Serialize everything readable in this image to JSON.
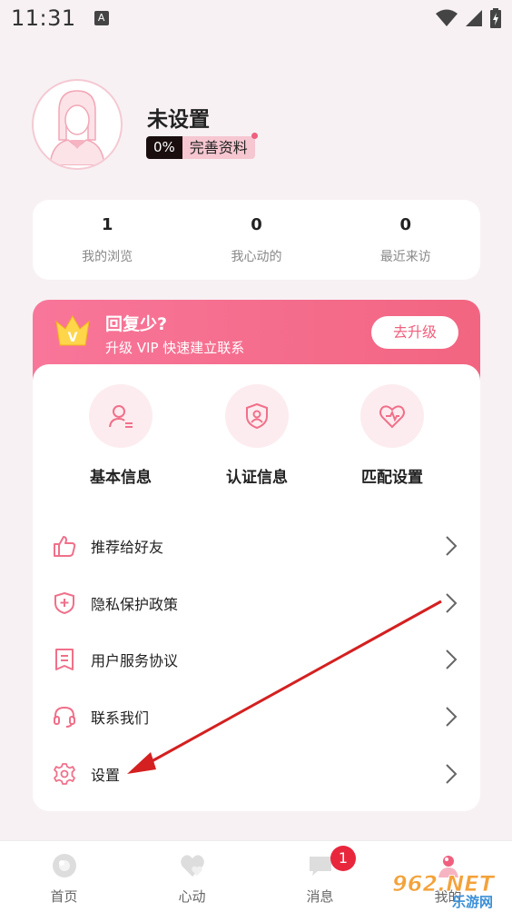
{
  "status_bar": {
    "time": "11:31",
    "notification_icon": "A"
  },
  "profile": {
    "nickname": "未设置",
    "completion_percent": "0%",
    "completion_label": "完善资料"
  },
  "stats": [
    {
      "count": "1",
      "label": "我的浏览"
    },
    {
      "count": "0",
      "label": "我心动的"
    },
    {
      "count": "0",
      "label": "最近来访"
    }
  ],
  "vip_banner": {
    "title": "回复少?",
    "subtitle": "升级 VIP 快速建立联系",
    "button_label": "去升级",
    "crown_letter": "V"
  },
  "quick_actions": [
    {
      "label": "基本信息",
      "icon": "user-profile-icon"
    },
    {
      "label": "认证信息",
      "icon": "shield-verify-icon"
    },
    {
      "label": "匹配设置",
      "icon": "heart-match-icon"
    }
  ],
  "menu": [
    {
      "label": "推荐给好友",
      "icon": "thumbs-up-icon"
    },
    {
      "label": "隐私保护政策",
      "icon": "shield-plus-icon"
    },
    {
      "label": "用户服务协议",
      "icon": "document-icon"
    },
    {
      "label": "联系我们",
      "icon": "headset-icon"
    },
    {
      "label": "设置",
      "icon": "gear-icon"
    }
  ],
  "tab_bar": [
    {
      "label": "首页",
      "icon": "home-icon"
    },
    {
      "label": "心动",
      "icon": "heart-icon"
    },
    {
      "label": "消息",
      "icon": "message-icon",
      "badge": "1"
    },
    {
      "label": "我的",
      "icon": "profile-icon"
    }
  ],
  "watermark": {
    "brand": "962.NET",
    "sub": "乐游网"
  },
  "colors": {
    "accent": "#f0607e",
    "banner_start": "#f8769a",
    "banner_end": "#f26581",
    "badge": "#e8273d",
    "annotation_arrow": "#d42020"
  }
}
